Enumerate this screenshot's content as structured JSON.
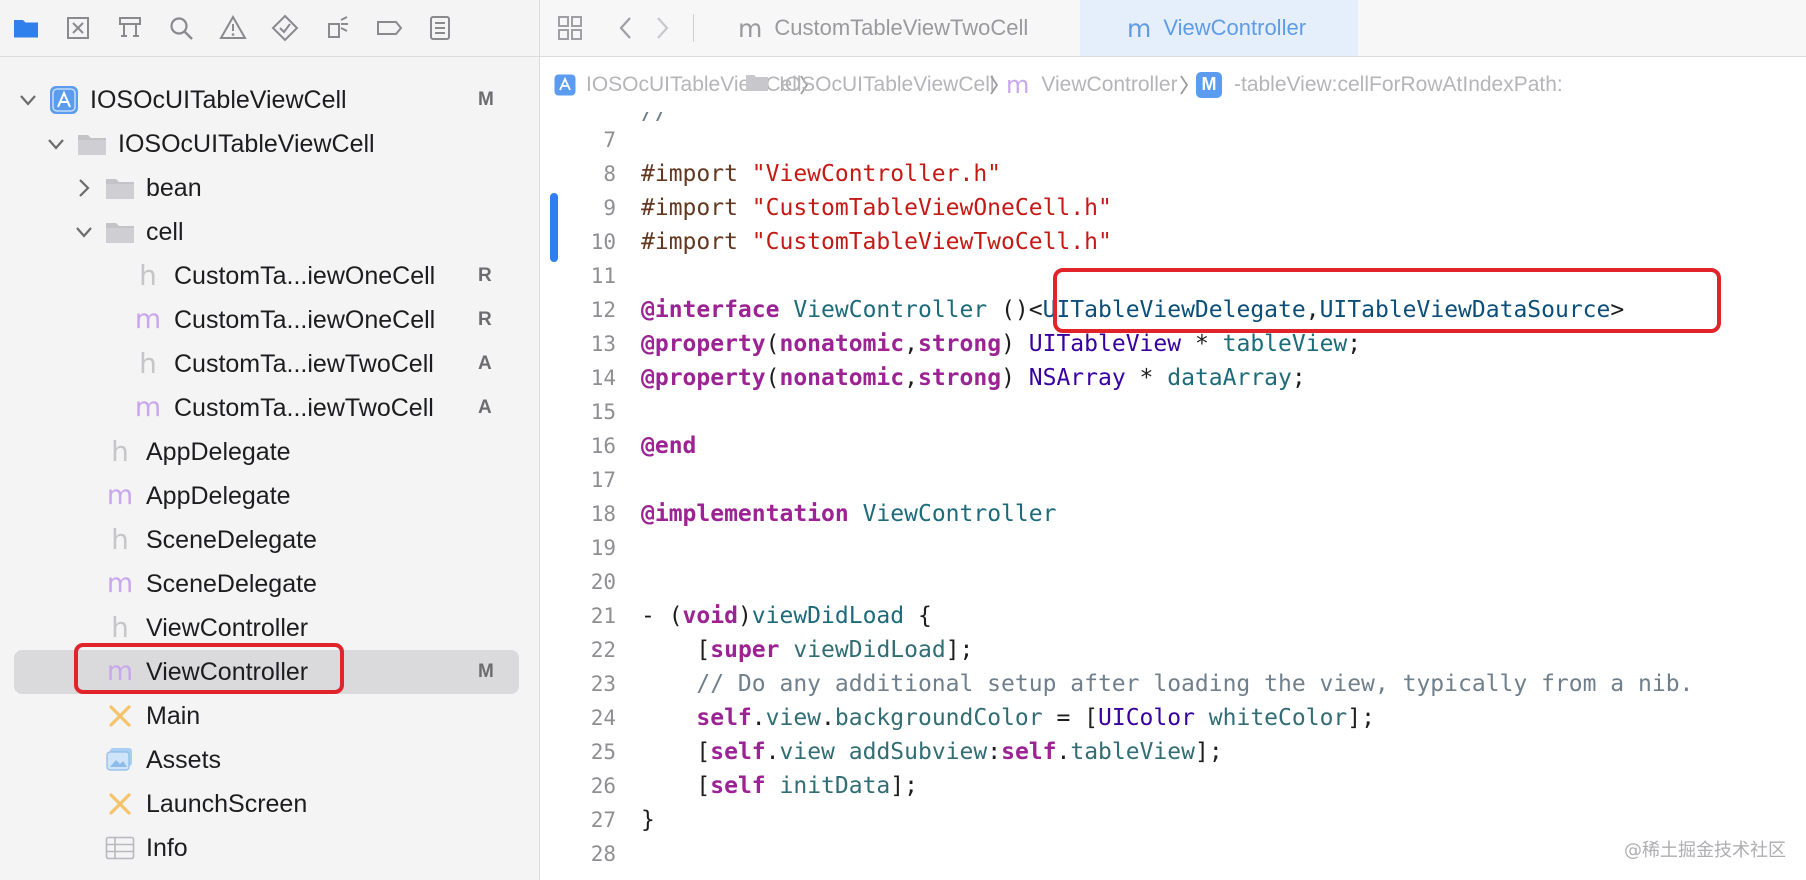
{
  "navigator": {
    "toolbar_icons": [
      "folder-icon",
      "source-control-icon",
      "hierarchy-icon",
      "search-icon",
      "warning-icon",
      "test-icon",
      "debug-icon",
      "breakpoint-icon",
      "report-icon"
    ],
    "rows": [
      {
        "label": "IOSOcUITableViewCell",
        "badge": "M",
        "indent": 0,
        "expander": "down",
        "icon": "project-icon",
        "selected": false
      },
      {
        "label": "IOSOcUITableViewCell",
        "badge": "",
        "indent": 1,
        "expander": "down",
        "icon": "folder-icon",
        "selected": false
      },
      {
        "label": "bean",
        "badge": "",
        "indent": 2,
        "expander": "right",
        "icon": "folder-icon",
        "selected": false
      },
      {
        "label": "cell",
        "badge": "",
        "indent": 2,
        "expander": "down",
        "icon": "folder-icon",
        "selected": false
      },
      {
        "label": "CustomTa...iewOneCell",
        "badge": "R",
        "indent": 3,
        "expander": "",
        "icon": "header-file-icon",
        "selected": false
      },
      {
        "label": "CustomTa...iewOneCell",
        "badge": "R",
        "indent": 3,
        "expander": "",
        "icon": "implementation-file-icon",
        "selected": false
      },
      {
        "label": "CustomTa...iewTwoCell",
        "badge": "A",
        "indent": 3,
        "expander": "",
        "icon": "header-file-icon",
        "selected": false
      },
      {
        "label": "CustomTa...iewTwoCell",
        "badge": "A",
        "indent": 3,
        "expander": "",
        "icon": "implementation-file-icon",
        "selected": false
      },
      {
        "label": "AppDelegate",
        "badge": "",
        "indent": 2,
        "expander": "",
        "icon": "header-file-icon",
        "selected": false
      },
      {
        "label": "AppDelegate",
        "badge": "",
        "indent": 2,
        "expander": "",
        "icon": "implementation-file-icon",
        "selected": false
      },
      {
        "label": "SceneDelegate",
        "badge": "",
        "indent": 2,
        "expander": "",
        "icon": "header-file-icon",
        "selected": false
      },
      {
        "label": "SceneDelegate",
        "badge": "",
        "indent": 2,
        "expander": "",
        "icon": "implementation-file-icon",
        "selected": false
      },
      {
        "label": "ViewController",
        "badge": "",
        "indent": 2,
        "expander": "",
        "icon": "header-file-icon",
        "selected": false
      },
      {
        "label": "ViewController",
        "badge": "M",
        "indent": 2,
        "expander": "",
        "icon": "implementation-file-icon",
        "selected": true
      },
      {
        "label": "Main",
        "badge": "",
        "indent": 2,
        "expander": "",
        "icon": "storyboard-icon",
        "selected": false
      },
      {
        "label": "Assets",
        "badge": "",
        "indent": 2,
        "expander": "",
        "icon": "asset-catalog-icon",
        "selected": false
      },
      {
        "label": "LaunchScreen",
        "badge": "",
        "indent": 2,
        "expander": "",
        "icon": "storyboard-icon",
        "selected": false
      },
      {
        "label": "Info",
        "badge": "",
        "indent": 2,
        "expander": "",
        "icon": "plist-icon",
        "selected": false
      }
    ]
  },
  "tabs": [
    {
      "glyph": "m",
      "label": "CustomTableViewTwoCell",
      "active": false
    },
    {
      "glyph": "m",
      "label": "ViewController",
      "active": true
    }
  ],
  "breadcrumb": [
    {
      "icon": "project-icon",
      "label": "IOSOcUITableViewCell"
    },
    {
      "icon": "folder-icon",
      "label": "IOSOcUITableViewCell"
    },
    {
      "icon": "implementation-file-icon",
      "glyph": "m",
      "label": "ViewController"
    },
    {
      "icon": "method-icon",
      "glyph": "M",
      "label": "-tableView:cellForRowAtIndexPath:"
    }
  ],
  "editor": {
    "top_partial": "//",
    "lines": [
      {
        "n": "7",
        "tokens": []
      },
      {
        "n": "8",
        "tokens": [
          [
            "dir",
            "#import "
          ],
          [
            "str",
            "\"ViewController.h\""
          ]
        ]
      },
      {
        "n": "9",
        "tokens": [
          [
            "dir",
            "#import "
          ],
          [
            "str",
            "\"CustomTableViewOneCell.h\""
          ]
        ]
      },
      {
        "n": "10",
        "tokens": [
          [
            "dir",
            "#import "
          ],
          [
            "str",
            "\"CustomTableViewTwoCell.h\""
          ]
        ]
      },
      {
        "n": "11",
        "tokens": []
      },
      {
        "n": "12",
        "tokens": [
          [
            "kw",
            "@interface"
          ],
          [
            "plain",
            " "
          ],
          [
            "ident",
            "ViewController"
          ],
          [
            "plain",
            " ()<"
          ],
          [
            "type",
            "UITableViewDelegate"
          ],
          [
            "plain",
            ","
          ],
          [
            "type",
            "UITableViewDataSource"
          ],
          [
            "plain",
            ">"
          ]
        ]
      },
      {
        "n": "13",
        "tokens": [
          [
            "kw",
            "@property"
          ],
          [
            "plain",
            "("
          ],
          [
            "kw",
            "nonatomic"
          ],
          [
            "plain",
            ","
          ],
          [
            "kw",
            "strong"
          ],
          [
            "plain",
            ") "
          ],
          [
            "cls",
            "UITableView"
          ],
          [
            "plain",
            " * "
          ],
          [
            "ident",
            "tableView"
          ],
          [
            "plain",
            ";"
          ]
        ]
      },
      {
        "n": "14",
        "tokens": [
          [
            "kw",
            "@property"
          ],
          [
            "plain",
            "("
          ],
          [
            "kw",
            "nonatomic"
          ],
          [
            "plain",
            ","
          ],
          [
            "kw",
            "strong"
          ],
          [
            "plain",
            ") "
          ],
          [
            "cls",
            "NSArray"
          ],
          [
            "plain",
            " * "
          ],
          [
            "ident",
            "dataArray"
          ],
          [
            "plain",
            ";"
          ]
        ]
      },
      {
        "n": "15",
        "tokens": []
      },
      {
        "n": "16",
        "tokens": [
          [
            "kw",
            "@end"
          ]
        ]
      },
      {
        "n": "17",
        "tokens": []
      },
      {
        "n": "18",
        "tokens": [
          [
            "kw",
            "@implementation"
          ],
          [
            "plain",
            " "
          ],
          [
            "ident",
            "ViewController"
          ]
        ]
      },
      {
        "n": "19",
        "tokens": []
      },
      {
        "n": "20",
        "tokens": []
      },
      {
        "n": "21",
        "tokens": [
          [
            "plain",
            "- ("
          ],
          [
            "kw",
            "void"
          ],
          [
            "plain",
            ")"
          ],
          [
            "ident",
            "viewDidLoad"
          ],
          [
            "plain",
            " {"
          ]
        ]
      },
      {
        "n": "22",
        "tokens": [
          [
            "plain",
            "    ["
          ],
          [
            "kw",
            "super"
          ],
          [
            "plain",
            " "
          ],
          [
            "prop",
            "viewDidLoad"
          ],
          [
            "plain",
            "];"
          ]
        ]
      },
      {
        "n": "23",
        "tokens": [
          [
            "cm",
            "    // Do any additional setup after loading the view, typically from a nib."
          ]
        ]
      },
      {
        "n": "24",
        "tokens": [
          [
            "plain",
            "    "
          ],
          [
            "kw",
            "self"
          ],
          [
            "plain",
            "."
          ],
          [
            "prop",
            "view"
          ],
          [
            "plain",
            "."
          ],
          [
            "prop",
            "backgroundColor"
          ],
          [
            "plain",
            " = ["
          ],
          [
            "cls",
            "UIColor"
          ],
          [
            "plain",
            " "
          ],
          [
            "prop",
            "whiteColor"
          ],
          [
            "plain",
            "];"
          ]
        ]
      },
      {
        "n": "25",
        "tokens": [
          [
            "plain",
            "    ["
          ],
          [
            "kw",
            "self"
          ],
          [
            "plain",
            "."
          ],
          [
            "prop",
            "view"
          ],
          [
            "plain",
            " "
          ],
          [
            "prop",
            "addSubview"
          ],
          [
            "plain",
            ":"
          ],
          [
            "kw",
            "self"
          ],
          [
            "plain",
            "."
          ],
          [
            "prop",
            "tableView"
          ],
          [
            "plain",
            "];"
          ]
        ]
      },
      {
        "n": "26",
        "tokens": [
          [
            "plain",
            "    ["
          ],
          [
            "kw",
            "self"
          ],
          [
            "plain",
            " "
          ],
          [
            "prop",
            "initData"
          ],
          [
            "plain",
            "];"
          ]
        ]
      },
      {
        "n": "27",
        "tokens": [
          [
            "plain",
            "}"
          ]
        ]
      },
      {
        "n": "28",
        "tokens": []
      }
    ]
  },
  "watermark": "@稀土掘金技术社区"
}
